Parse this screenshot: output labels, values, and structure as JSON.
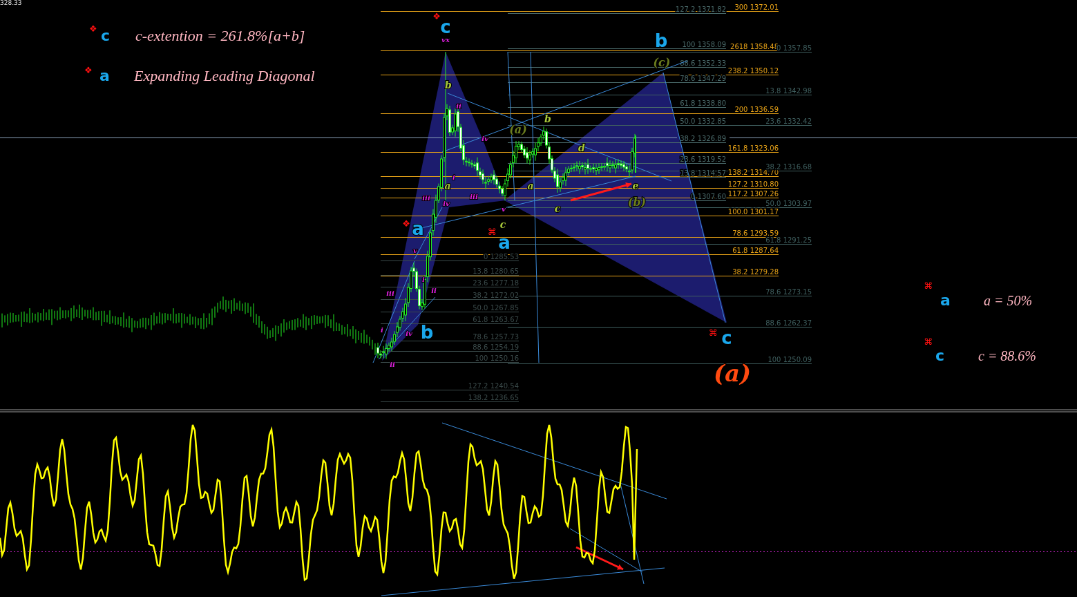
{
  "price_readout": "328.33",
  "legend_top": [
    {
      "marker": "❖",
      "wave": "c",
      "text": "c-extention = 261.8%[a+b]"
    },
    {
      "marker": "❖",
      "wave": "a",
      "text": "Expanding Leading Diagonal"
    }
  ],
  "legend_right": [
    {
      "marker": "⌘",
      "wave": "a",
      "text": "a = 50%"
    },
    {
      "marker": "⌘",
      "wave": "c",
      "text": "c = 88.6%"
    }
  ],
  "fib_sets": [
    {
      "color": "#4a6a6a",
      "levels": [
        "127.2 1371.82",
        "100 1358.09",
        "88.6 1352.33",
        "78.6 1347.29",
        "61.8 1338.80",
        "50.0 1332.85",
        "38.2 1326.89",
        "23.6 1319.52",
        "13.8 1314.57",
        "0 1307.60"
      ]
    },
    {
      "color": "#e8a317",
      "levels": [
        "300 1372.01",
        "2618 1358.48",
        "238.2 1350.12",
        "200 1336.59",
        "161.8 1323.06",
        "138.2 1314.70",
        "127.2 1310.80",
        "117.2 1307.26",
        "100.0 1301.17",
        "78.6 1293.59",
        "61.8 1287.64",
        "38.2 1279.28"
      ]
    },
    {
      "color": "#3f5f5f",
      "levels": [
        "0 1357.85",
        "13.8 1342.98",
        "23.6 1332.42",
        "38.2 1316.68",
        "50.0 1303.97",
        "61.8 1291.25",
        "78.6 1273.15",
        "88.6 1262.37",
        "100 1250.09"
      ]
    },
    {
      "color": "#3a4a4a",
      "levels": [
        "0 1285.53",
        "13.8 1280.65",
        "23.6 1277.18",
        "38.2 1272.02",
        "50.0 1267.85",
        "61.8 1263.67",
        "78.6 1257.73",
        "88.6 1254.19",
        "100 1250.16",
        "127.2 1240.54",
        "138.2 1236.65"
      ]
    }
  ],
  "wave_labels": [
    {
      "text": "c",
      "kind": "major"
    },
    {
      "text": "b",
      "kind": "major"
    },
    {
      "text": "a",
      "kind": "major"
    },
    {
      "text": "a",
      "kind": "major"
    },
    {
      "text": "b",
      "kind": "major"
    },
    {
      "text": "c",
      "kind": "major"
    },
    {
      "text": "❖",
      "kind": "marker"
    },
    {
      "text": "❖",
      "kind": "marker"
    },
    {
      "text": "⌘",
      "kind": "marker"
    },
    {
      "text": "⌘",
      "kind": "marker"
    },
    {
      "text": "(a)",
      "kind": "primary"
    },
    {
      "text": "(c)",
      "kind": "intermediate"
    },
    {
      "text": "(a)",
      "kind": "intermediate"
    },
    {
      "text": "(b)",
      "kind": "intermediate"
    },
    {
      "text": "b",
      "kind": "minor"
    },
    {
      "text": "b",
      "kind": "minor"
    },
    {
      "text": "d",
      "kind": "minor"
    },
    {
      "text": "a",
      "kind": "minor"
    },
    {
      "text": "a",
      "kind": "minor"
    },
    {
      "text": "e",
      "kind": "minor"
    },
    {
      "text": "c",
      "kind": "minor"
    },
    {
      "text": "c",
      "kind": "minor"
    },
    {
      "text": "vx",
      "kind": "roman"
    },
    {
      "text": "ii",
      "kind": "roman"
    },
    {
      "text": "iv",
      "kind": "roman"
    },
    {
      "text": "i",
      "kind": "roman"
    },
    {
      "text": "iii",
      "kind": "roman"
    },
    {
      "text": "iii",
      "kind": "roman"
    },
    {
      "text": "iv",
      "kind": "roman"
    },
    {
      "text": "v",
      "kind": "roman"
    },
    {
      "text": "v",
      "kind": "roman"
    },
    {
      "text": "iii",
      "kind": "roman"
    },
    {
      "text": "i",
      "kind": "roman"
    },
    {
      "text": "ii",
      "kind": "roman"
    },
    {
      "text": "i",
      "kind": "roman"
    },
    {
      "text": "iv",
      "kind": "roman"
    },
    {
      "text": "ii",
      "kind": "roman"
    }
  ]
}
